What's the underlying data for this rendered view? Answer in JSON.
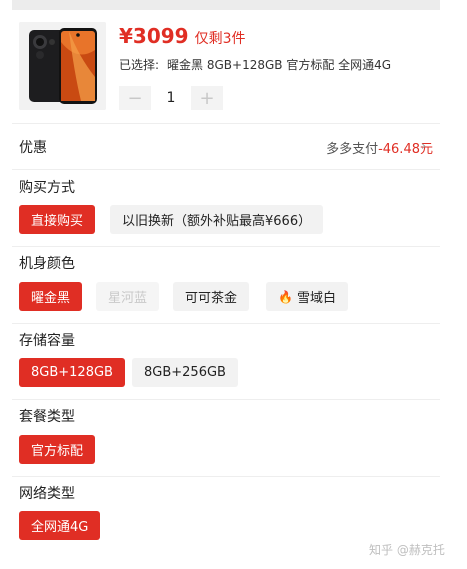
{
  "product": {
    "price": "¥3099",
    "stock": "仅剩3件",
    "selected_prefix": "已选择:",
    "selected_value": "曜金黑 8GB+128GB 官方标配 全网通4G",
    "quantity": "1",
    "minus": "−",
    "plus": "+"
  },
  "discount": {
    "title": "优惠",
    "label": "多多支付",
    "amount": "-46.48元",
    "chevron": "›"
  },
  "sections": {
    "purchase": {
      "title": "购买方式",
      "options": [
        "直接购买",
        "以旧换新（额外补贴最高¥666）"
      ]
    },
    "color": {
      "title": "机身颜色",
      "options": [
        "曜金黑",
        "星河蓝",
        "可可茶金",
        "雪域白"
      ]
    },
    "storage": {
      "title": "存储容量",
      "options": [
        "8GB+128GB",
        "8GB+256GB"
      ]
    },
    "package": {
      "title": "套餐类型",
      "options": [
        "官方标配"
      ]
    },
    "network": {
      "title": "网络类型",
      "options": [
        "全网通4G"
      ]
    }
  },
  "watermark": "知乎 @赫克托",
  "colors": {
    "accent": "#e02e24",
    "chip_bg": "#f2f2f2",
    "disabled_text": "#c9c9c9"
  }
}
